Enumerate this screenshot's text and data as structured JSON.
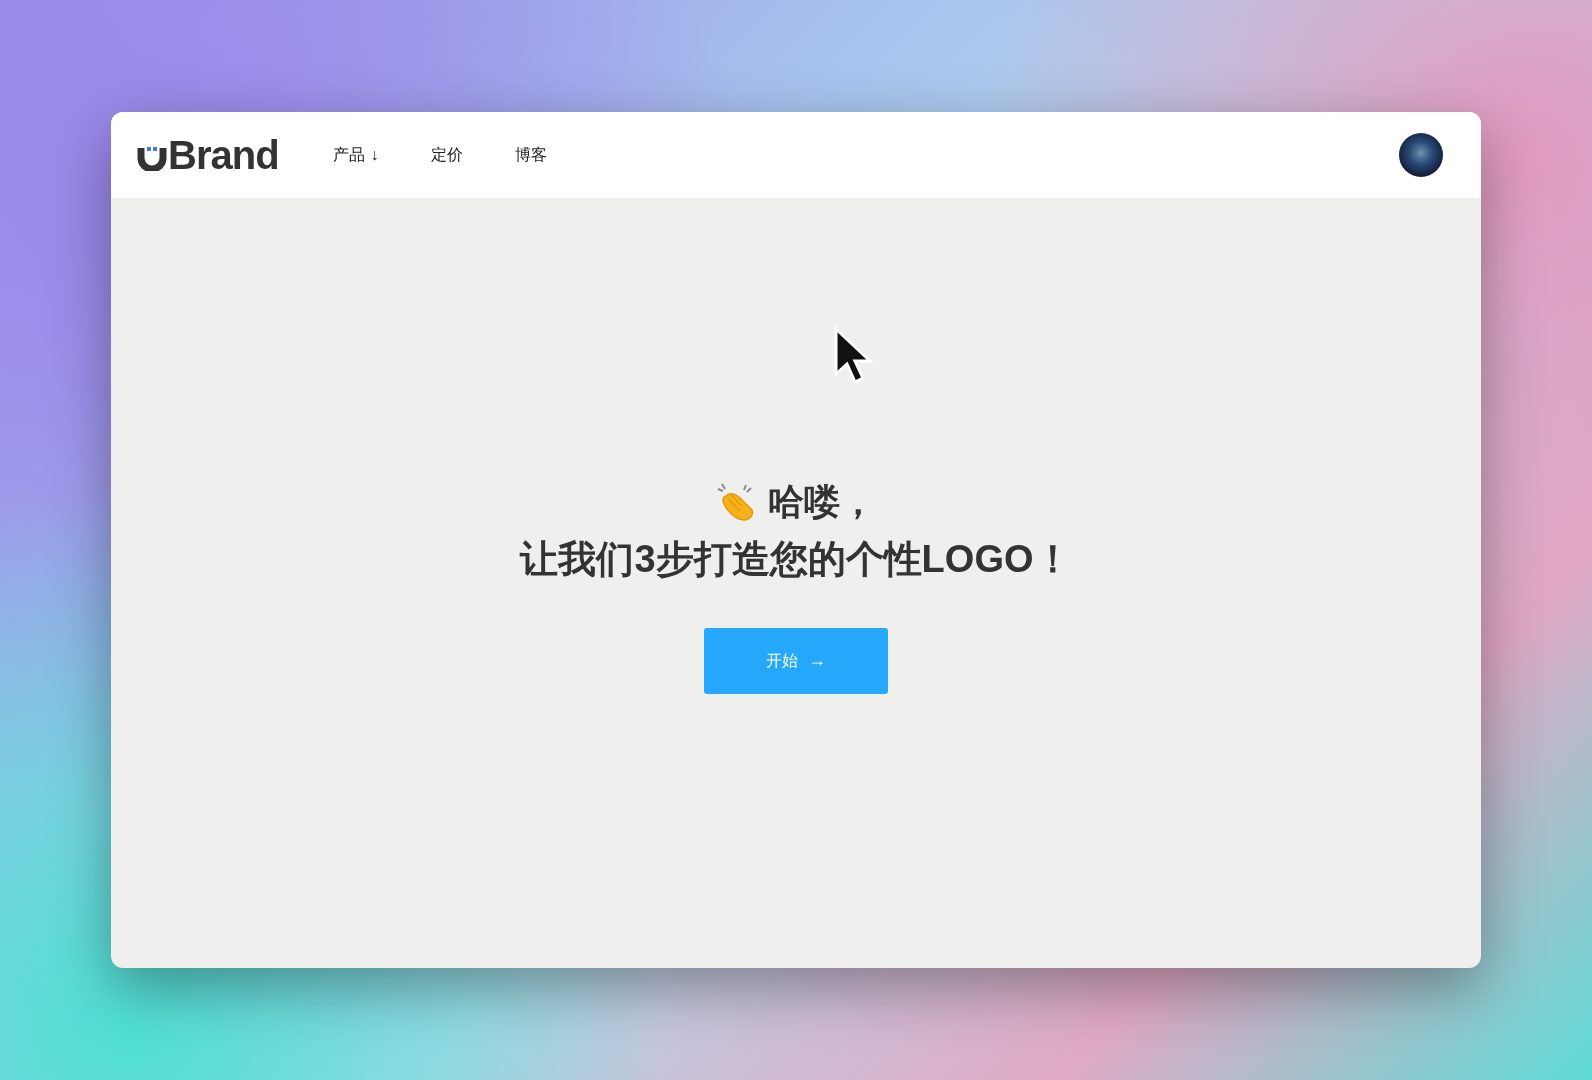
{
  "header": {
    "logo": "Brand",
    "nav": [
      {
        "label": "产品",
        "caret": "↓"
      },
      {
        "label": "定价"
      },
      {
        "label": "博客"
      }
    ]
  },
  "hero": {
    "greeting": "哈喽，",
    "headline": "让我们3步打造您的个性LOGO！",
    "button": {
      "label": "开始",
      "arrow": "→"
    }
  }
}
